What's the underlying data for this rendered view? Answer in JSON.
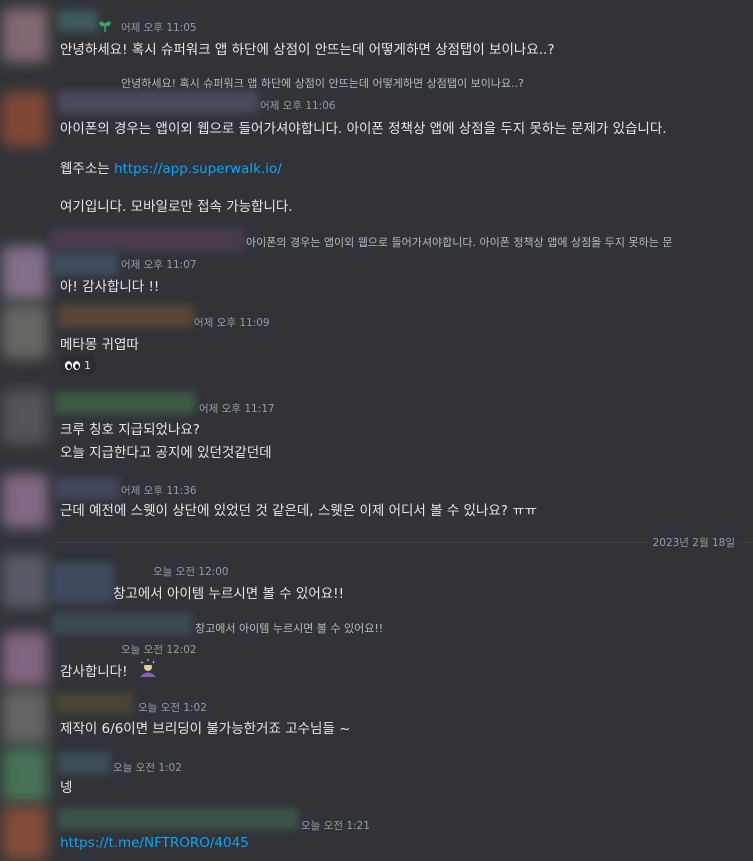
{
  "messages": [
    {
      "time": "어제 오후 11:05",
      "lines": [
        "안녕하세요! 혹시 슈퍼워크 앱 하단에 상점이 안뜨는데 어떻게하면 상점탭이 보이나요..?"
      ]
    },
    {
      "reply": "안녕하세요! 혹시 슈퍼워크 앱 하단에 상점이 안뜨는데 어떻게하면 상점탭이 보이나요..?",
      "time": "어제 오후 11:06",
      "lines": [
        "아이폰의 경우는 앱이외 웹으로 들어가셔야합니다. 아이폰 정책상 앱에 상점을 두지 못하는 문제가 있습니다.",
        "웹주소는 ",
        "https://app.superwalk.io/",
        "여기입니다. 모바일로만 접속 가능합니다."
      ]
    },
    {
      "reply": "아이폰의 경우는 앱이외 웹으로 들어가셔야합니다. 아이폰 정책상 앱에 상점을 두지 못하는 문",
      "time": "어제 오후 11:07",
      "lines": [
        "아! 감사합니다 !!"
      ]
    },
    {
      "time": "어제 오후 11:09",
      "lines": [
        "메타몽 귀엽따"
      ],
      "reaction_count": "1"
    },
    {
      "time": "어제 오후 11:17",
      "lines": [
        "크루 칭호 지급되었나요?",
        "오늘 지급한다고 공지에 있던것같던데"
      ]
    },
    {
      "time": "어제 오후 11:36",
      "lines": [
        "근데 예전에 스웻이 상단에 있었던 것 같은데, 스웻은 이제 어디서 볼 수 있나요? ㅠㅠ"
      ]
    },
    {
      "time": "오늘 오전 12:00",
      "lines": [
        "창고에서 아이템 누르시면 볼 수 있어요!!"
      ]
    },
    {
      "reply": "창고에서 아이템 누르시면 볼 수 있어요!!",
      "time": "오늘 오전 12:02",
      "lines": [
        "감사합니다!"
      ]
    },
    {
      "time": "오늘 오전 1:02",
      "lines": [
        "제작이 6/6이면 브리딩이 불가능한거죠 고수님들 ~"
      ]
    },
    {
      "time": "오늘 오전 1:02",
      "lines": [
        "넹"
      ]
    },
    {
      "time": "오늘 오전 1:21",
      "lines": [
        "https://t.me/NFTRORO/4045"
      ]
    }
  ],
  "date_divider": "2023년 2월 18일",
  "colors": {
    "background": "#313338",
    "link": "#00a8fc",
    "muted": "#949ba4"
  }
}
